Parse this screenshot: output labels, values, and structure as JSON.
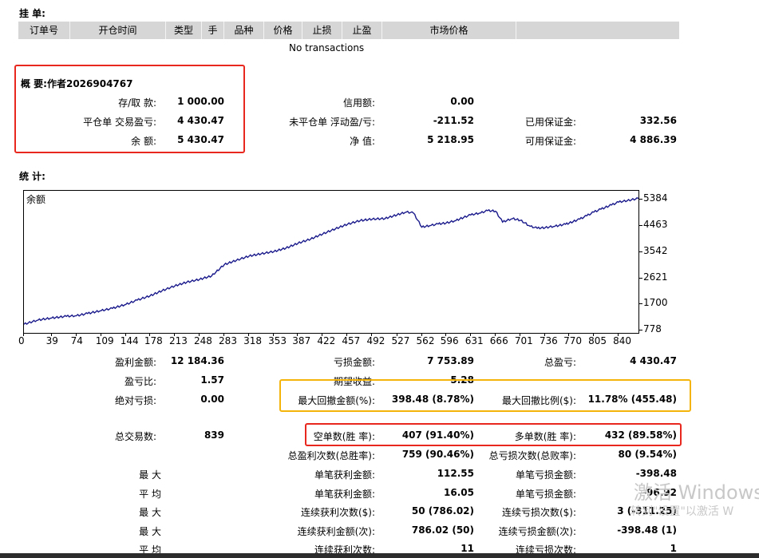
{
  "pending": {
    "title": "挂 单:",
    "columns": [
      "订单号",
      "开仓时间",
      "类型",
      "手",
      "品种",
      "价格",
      "止损",
      "止盈",
      "市场价格",
      ""
    ],
    "empty_text": "No transactions"
  },
  "summary": {
    "title": "概 要:作者2026904767",
    "deposit_label": "存/取 款:",
    "deposit_value": "1 000.00",
    "closed_pl_label": "平仓单 交易盈亏:",
    "closed_pl_value": "4 430.47",
    "balance_label": "余 额:",
    "balance_value": "5 430.47",
    "credit_label": "信用额:",
    "credit_value": "0.00",
    "floating_label": "未平仓单 浮动盈/亏:",
    "floating_value": "-211.52",
    "equity_label": "净 值:",
    "equity_value": "5 218.95",
    "margin_label": "已用保证金:",
    "margin_value": "332.56",
    "free_margin_label": "可用保证金:",
    "free_margin_value": "4 886.39"
  },
  "stats_title": "统 计:",
  "chart_data": {
    "type": "line",
    "title": "余额",
    "x_ticks": [
      0,
      39,
      74,
      109,
      144,
      178,
      213,
      248,
      283,
      318,
      353,
      387,
      422,
      457,
      492,
      527,
      562,
      596,
      631,
      666,
      701,
      736,
      770,
      805,
      840
    ],
    "y_ticks": [
      778,
      1700,
      2621,
      3542,
      4463,
      5384
    ],
    "xlim": [
      0,
      868
    ],
    "ylim": [
      700,
      5700
    ],
    "x": [
      0,
      20,
      39,
      60,
      74,
      90,
      109,
      125,
      144,
      160,
      178,
      195,
      213,
      230,
      248,
      265,
      283,
      300,
      318,
      335,
      353,
      370,
      387,
      405,
      422,
      440,
      457,
      475,
      492,
      510,
      527,
      540,
      550,
      562,
      575,
      585,
      596,
      610,
      621,
      631,
      645,
      655,
      666,
      676,
      690,
      701,
      715,
      725,
      736,
      750,
      765,
      770,
      785,
      795,
      805,
      815,
      830,
      840,
      852,
      868
    ],
    "y": [
      1000,
      1150,
      1220,
      1280,
      1300,
      1380,
      1480,
      1560,
      1700,
      1850,
      2000,
      2180,
      2350,
      2480,
      2580,
      2700,
      3100,
      3250,
      3400,
      3480,
      3560,
      3680,
      3850,
      4000,
      4180,
      4360,
      4520,
      4650,
      4700,
      4720,
      4850,
      4950,
      4920,
      4420,
      4480,
      4530,
      4560,
      4650,
      4760,
      4850,
      4920,
      5000,
      4980,
      4600,
      4720,
      4660,
      4450,
      4380,
      4400,
      4450,
      4520,
      4560,
      4700,
      4820,
      4950,
      5050,
      5200,
      5300,
      5350,
      5430
    ],
    "grid": false
  },
  "stats": {
    "gross_profit_label": "盈利金额:",
    "gross_profit_value": "12 184.36",
    "gross_loss_label": "亏损金额:",
    "gross_loss_value": "7 753.89",
    "total_profit_label": "总盈亏:",
    "total_profit_value": "4 430.47",
    "profit_factor_label": "盈亏比:",
    "profit_factor_value": "1.57",
    "expected_label": "期望收益:",
    "expected_value": "5.28",
    "abs_dd_label": "绝对亏损:",
    "abs_dd_value": "0.00",
    "max_dd_label": "最大回撤金额(%):",
    "max_dd_value": "398.48 (8.78%)",
    "rel_dd_label": "最大回撤比例($):",
    "rel_dd_value": "11.78% (455.48)",
    "total_trades_label": "总交易数:",
    "total_trades_value": "839",
    "short_label": "空单数(胜 率):",
    "short_value": "407 (91.40%)",
    "long_label": "多单数(胜 率):",
    "long_value": "432 (89.58%)",
    "profit_trades_label": "总盈利次数(总胜率):",
    "profit_trades_value": "759 (90.46%)",
    "loss_trades_label": "总亏损次数(总败率):",
    "loss_trades_value": "80 (9.54%)",
    "row_max1": "最 大",
    "largest_profit_label": "单笔获利金额:",
    "largest_profit_value": "112.55",
    "largest_loss_label": "单笔亏损金额:",
    "largest_loss_value": "-398.48",
    "row_avg1": "平 均",
    "avg_profit_label": "单笔获利金额:",
    "avg_profit_value": "16.05",
    "avg_loss_label": "单笔亏损金额:",
    "avg_loss_value": "-96.92",
    "row_max2": "最 大",
    "max_cons_wins_label": "连续获利次数($):",
    "max_cons_wins_value": "50 (786.02)",
    "max_cons_losses_label": "连续亏损次数($):",
    "max_cons_losses_value": "3 (-311.25)",
    "row_max3": "最 大",
    "max_cons_profit_label": "连续获利金额(次):",
    "max_cons_profit_value": "786.02 (50)",
    "max_cons_loss_label": "连续亏损金额(次):",
    "max_cons_loss_value": "-398.48 (1)",
    "row_avg2": "平 均",
    "avg_cons_wins_label": "连续获利次数:",
    "avg_cons_wins_value": "11",
    "avg_cons_losses_label": "连续亏损次数:",
    "avg_cons_losses_value": "1"
  },
  "watermark": {
    "line1": "激活 Windows",
    "line2": "转到\"设置\"以激活 W"
  }
}
